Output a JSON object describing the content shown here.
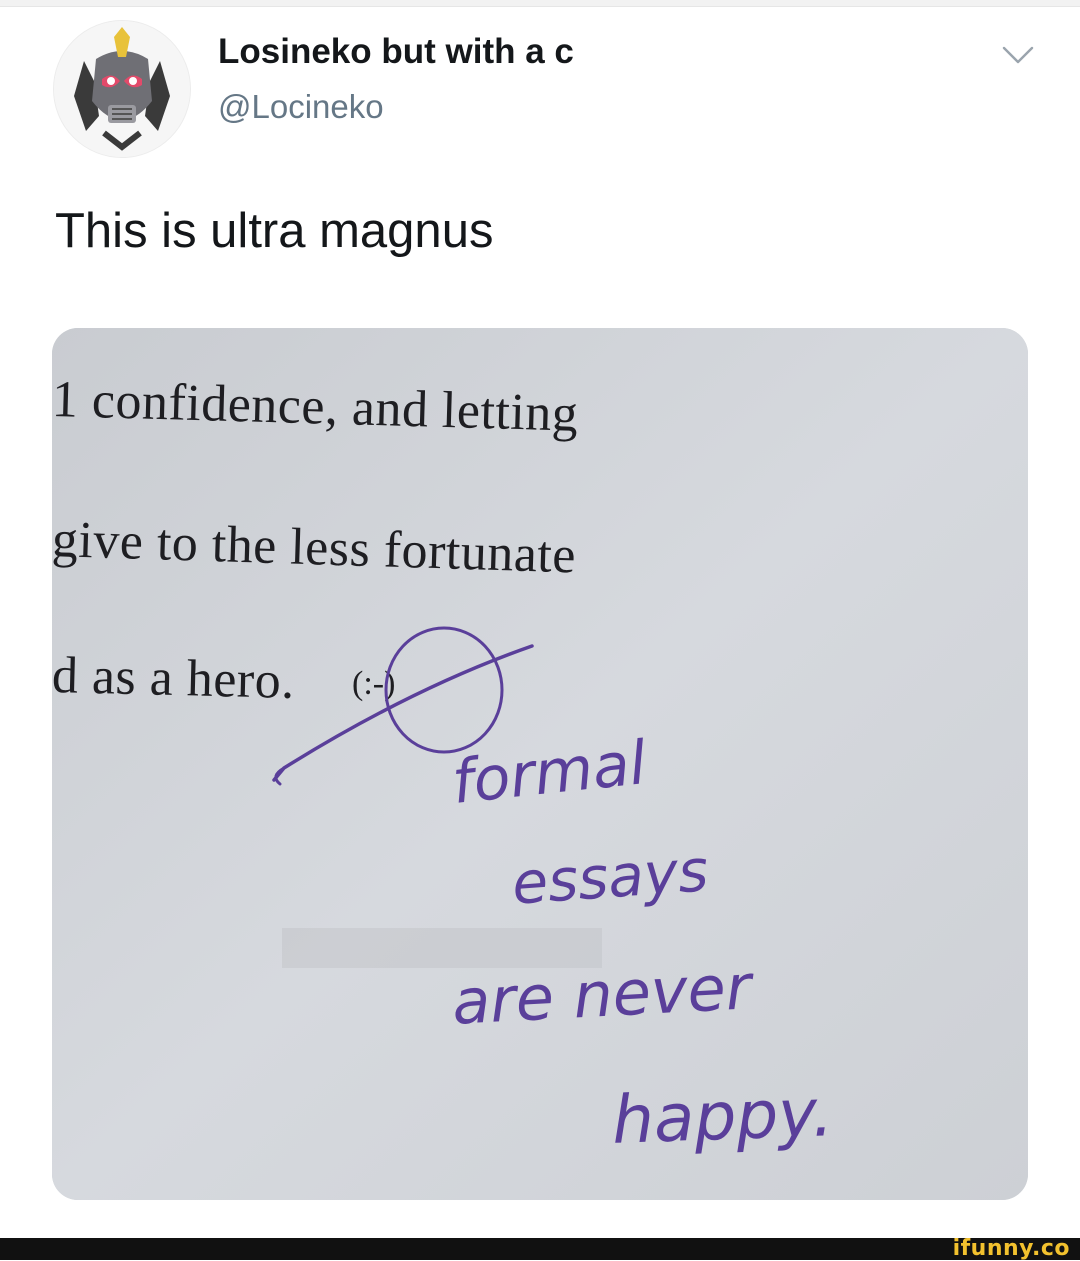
{
  "tweet": {
    "display_name": "Losineko but with a c",
    "handle": "@Locineko",
    "text": "This is ultra magnus"
  },
  "photo": {
    "printed_lines": [
      "1 confidence, and letting",
      "give to the less fortunate",
      "d as a hero."
    ],
    "crossed_emoticon": "(:-)",
    "handwritten_note": [
      "formal",
      "essays",
      "are never",
      "happy."
    ]
  },
  "footer": {
    "brand": "ifunny.co"
  },
  "colors": {
    "name_text": "#14171a",
    "handle_text": "#657786",
    "paper": "#c8ccd2",
    "ink": "#5a3f9a",
    "brand": "#f2c12e"
  }
}
